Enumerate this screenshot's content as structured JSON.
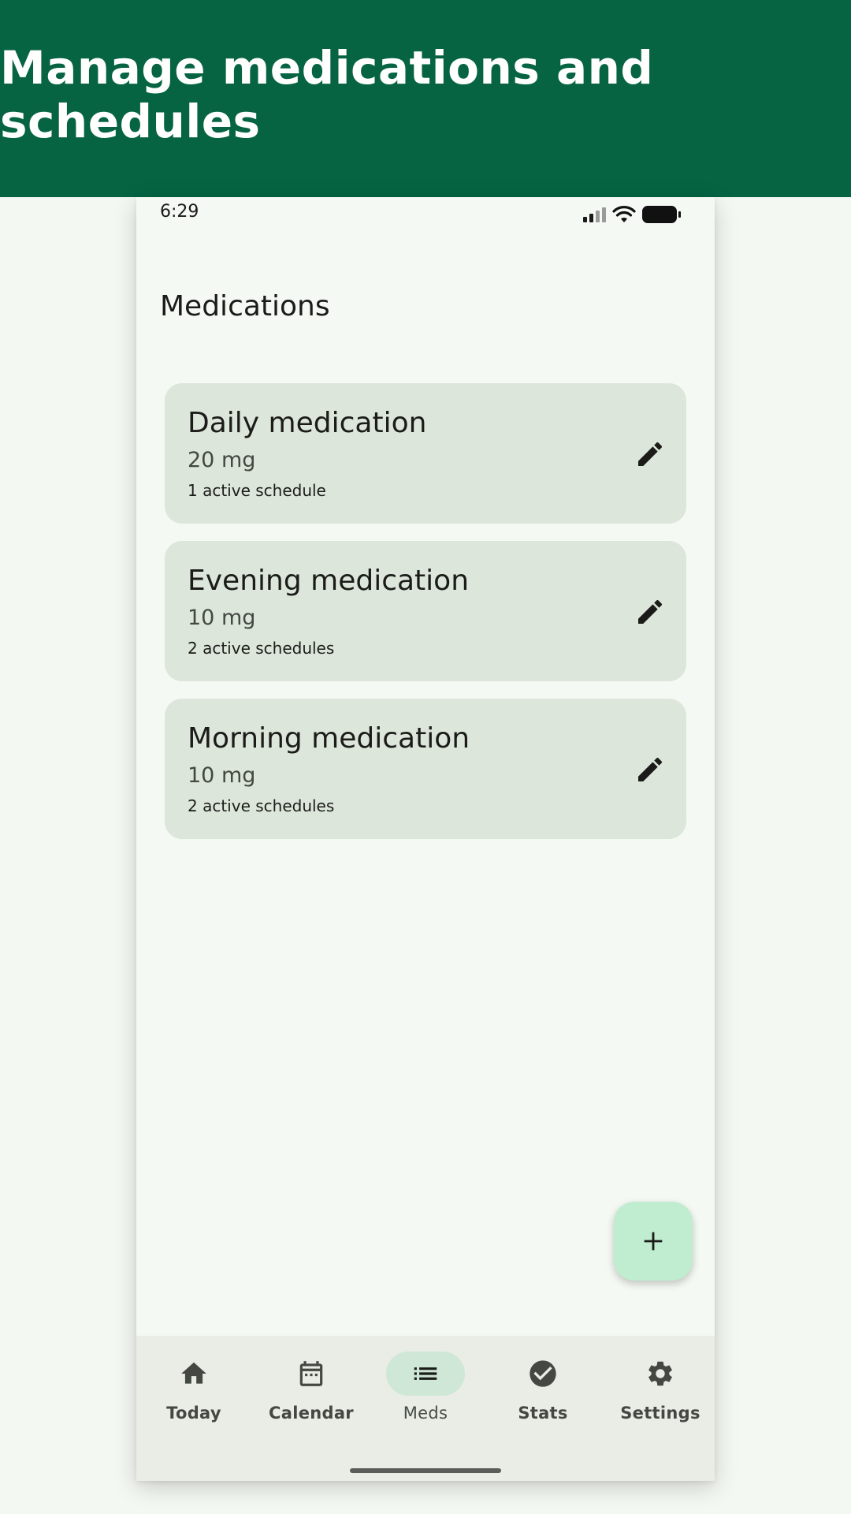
{
  "banner": {
    "title": "Manage medications and schedules"
  },
  "status_bar": {
    "time": "6:29",
    "icons": [
      "signal-icon",
      "wifi-icon",
      "battery-icon"
    ]
  },
  "header": {
    "title": "Medications"
  },
  "medications": [
    {
      "name": "Daily medication",
      "dose": "20 mg",
      "schedules": "1 active schedule"
    },
    {
      "name": "Evening medication",
      "dose": "10 mg",
      "schedules": "2 active schedules"
    },
    {
      "name": "Morning medication",
      "dose": "10 mg",
      "schedules": "2 active schedules"
    }
  ],
  "fab": {
    "icon": "add-icon"
  },
  "nav": {
    "items": [
      {
        "label": "Today",
        "icon": "home-icon"
      },
      {
        "label": "Calendar",
        "icon": "calendar-icon"
      },
      {
        "label": "Meds",
        "icon": "list-icon",
        "active": true
      },
      {
        "label": "Stats",
        "icon": "check-circle-icon"
      },
      {
        "label": "Settings",
        "icon": "gear-icon"
      }
    ]
  },
  "colors": {
    "banner": "#066443",
    "background": "#f5f9f3",
    "card": "#dde6da",
    "fab": "#c0ecd0",
    "nav_bar": "#e9ede6",
    "nav_active_pill": "#cfe7d6"
  }
}
